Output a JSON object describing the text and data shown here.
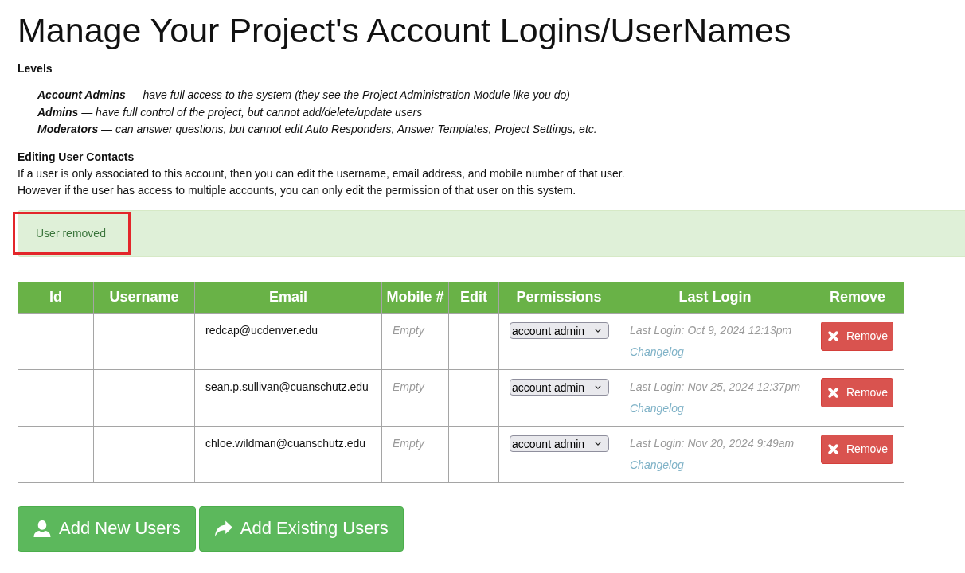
{
  "title": "Manage Your Project's Account Logins/UserNames",
  "levels": {
    "heading": "Levels",
    "items": [
      "**Account Admins** — have full access to the system (they see the Project Administration Module like you do)",
      "**Admins** — have full control of the project, but cannot add/delete/update users",
      "**Moderators** — can answer questions, but cannot edit Auto Responders, Answer Templates, Project Settings, etc."
    ]
  },
  "editing": {
    "heading": "Editing User Contacts",
    "lines": [
      "If a user is only associated to this account, then you can edit the username, email address, and mobile number of that user.",
      "However if the user has access to multiple accounts, you can only edit the permission of that user on this system."
    ]
  },
  "alert": {
    "message": "User removed",
    "highlighted": true
  },
  "table": {
    "columns": [
      "Id",
      "Username",
      "Email",
      "Mobile #",
      "Edit",
      "Permissions",
      "Last Login",
      "Remove"
    ],
    "rows": [
      {
        "email": "redcap@ucdenver.edu",
        "mobile": "Empty",
        "permission": "account admin",
        "last_login": "Last Login: Oct 9, 2024 12:13pm",
        "changelog": "Changelog",
        "remove": "Remove"
      },
      {
        "email": "sean.p.sullivan@cuanschutz.edu",
        "mobile": "Empty",
        "permission": "account admin",
        "last_login": "Last Login: Nov 25, 2024 12:37pm",
        "changelog": "Changelog",
        "remove": "Remove"
      },
      {
        "email": "chloe.wildman@cuanschutz.edu",
        "mobile": "Empty",
        "permission": "account admin",
        "last_login": "Last Login: Nov 20, 2024 9:49am",
        "changelog": "Changelog",
        "remove": "Remove"
      }
    ]
  },
  "buttons": [
    {
      "label": "Add New Users",
      "kind": "new"
    },
    {
      "label": "Add Existing Users",
      "kind": "existing"
    }
  ]
}
